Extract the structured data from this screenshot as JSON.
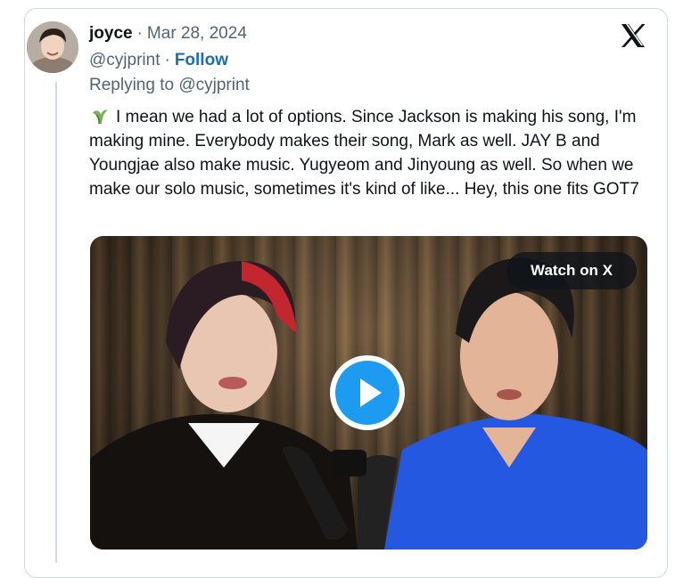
{
  "post": {
    "author_name": "joyce",
    "separator": "·",
    "date": "Mar 28, 2024",
    "handle": "@cyjprint",
    "follow_label": "Follow",
    "replying_prefix": "Replying to",
    "replying_to": "@cyjprint",
    "text": "I mean we had a lot of options. Since Jackson is making his song, I'm making mine. Everybody makes their song, Mark as well. JAY B and Youngjae also make music. Yugyeom and Jinyoung as well. So when we make our solo music, sometimes it's kind of like... Hey, this one fits GOT7"
  },
  "media": {
    "watch_label": "Watch on X"
  },
  "icons": {
    "brand": "x-logo-icon",
    "play": "play-icon",
    "emoji": "sprout-emoji-icon"
  },
  "colors": {
    "follow": "#1d6fa8",
    "muted": "#536471",
    "play_blue": "#1d9bf0"
  }
}
